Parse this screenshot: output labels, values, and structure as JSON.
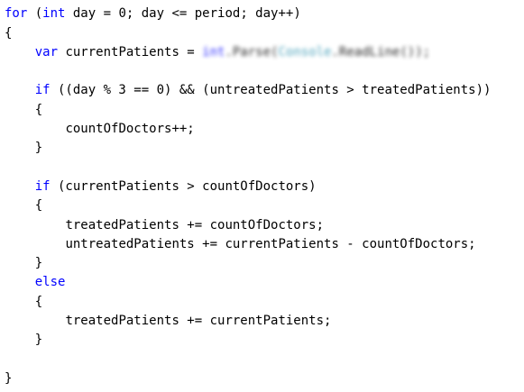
{
  "editor": {
    "language": "C#",
    "colors": {
      "keyword": "#0000ff",
      "text": "#000000",
      "type": "#2b91af",
      "background": "#ffffff"
    },
    "blurred_region_note_visible": false,
    "lines": [
      {
        "indent": "",
        "segments": [
          {
            "t": "for",
            "k": "kw"
          },
          {
            "t": " ("
          },
          {
            "t": "int",
            "k": "kw"
          },
          {
            "t": " day = 0; day <= period; day++)"
          }
        ]
      },
      {
        "indent": "",
        "segments": [
          {
            "t": "{"
          }
        ]
      },
      {
        "indent": "    ",
        "segments": [
          {
            "t": "var",
            "k": "kw"
          },
          {
            "t": " currentPatients = "
          },
          {
            "t": "int",
            "k": "blur-kw"
          },
          {
            "t": ".Parse(",
            "k": "blur"
          },
          {
            "t": "Console",
            "k": "blur-cls"
          },
          {
            "t": ".ReadLine());",
            "k": "blur"
          }
        ]
      },
      {
        "indent": "",
        "segments": []
      },
      {
        "indent": "    ",
        "segments": [
          {
            "t": "if",
            "k": "kw"
          },
          {
            "t": " ((day % 3 == 0) && (untreatedPatients > treatedPatients))"
          }
        ]
      },
      {
        "indent": "    ",
        "segments": [
          {
            "t": "{"
          }
        ]
      },
      {
        "indent": "        ",
        "segments": [
          {
            "t": "countOfDoctors++;"
          }
        ]
      },
      {
        "indent": "    ",
        "segments": [
          {
            "t": "}"
          }
        ]
      },
      {
        "indent": "",
        "segments": []
      },
      {
        "indent": "    ",
        "segments": [
          {
            "t": "if",
            "k": "kw"
          },
          {
            "t": " (currentPatients > countOfDoctors)"
          }
        ]
      },
      {
        "indent": "    ",
        "segments": [
          {
            "t": "{"
          }
        ]
      },
      {
        "indent": "        ",
        "segments": [
          {
            "t": "treatedPatients += countOfDoctors;"
          }
        ]
      },
      {
        "indent": "        ",
        "segments": [
          {
            "t": "untreatedPatients += currentPatients - countOfDoctors;"
          }
        ]
      },
      {
        "indent": "    ",
        "segments": [
          {
            "t": "}"
          }
        ]
      },
      {
        "indent": "    ",
        "segments": [
          {
            "t": "else",
            "k": "kw"
          }
        ]
      },
      {
        "indent": "    ",
        "segments": [
          {
            "t": "{"
          }
        ]
      },
      {
        "indent": "        ",
        "segments": [
          {
            "t": "treatedPatients += currentPatients;"
          }
        ]
      },
      {
        "indent": "    ",
        "segments": [
          {
            "t": "}"
          }
        ]
      },
      {
        "indent": "",
        "segments": []
      },
      {
        "indent": "",
        "segments": [
          {
            "t": "}"
          }
        ]
      }
    ]
  }
}
